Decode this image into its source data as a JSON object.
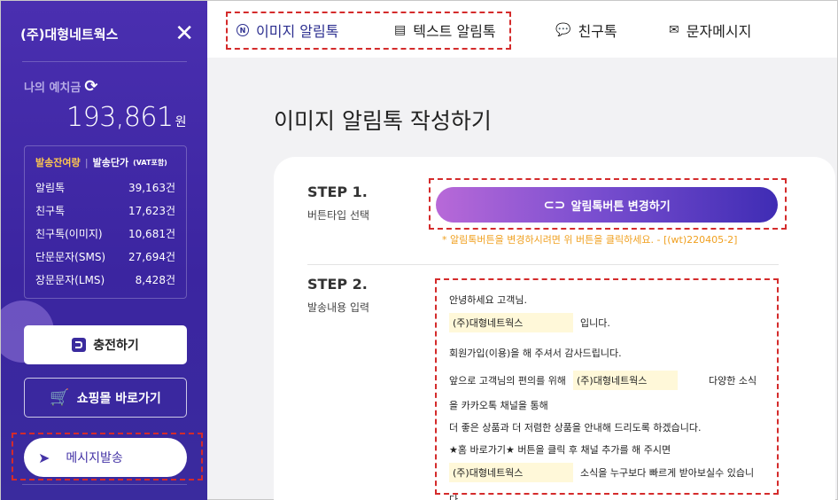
{
  "sidebar": {
    "company": "(주)대형네트웍스",
    "deposit_label": "나의 예치금",
    "deposit_amount": "193,861",
    "deposit_unit": "원",
    "stats_tab_active": "발송잔여량",
    "stats_tab_other": "발송단가",
    "stats_tab_vat": "(VAT포함)",
    "stats": [
      {
        "label": "알림톡",
        "value": "39,163건"
      },
      {
        "label": "친구톡",
        "value": "17,623건"
      },
      {
        "label": "친구톡(이미지)",
        "value": "10,681건"
      },
      {
        "label": "단문문자(SMS)",
        "value": "27,694건"
      },
      {
        "label": "장문문자(LMS)",
        "value": "8,428건"
      }
    ],
    "charge_button": "충전하기",
    "shop_button": "쇼핑몰 바로가기",
    "message_button": "메시지발송"
  },
  "tabs": [
    {
      "label": "이미지 알림톡",
      "icon": "n-circle-icon"
    },
    {
      "label": "텍스트 알림톡",
      "icon": "message-square-icon"
    },
    {
      "label": "친구톡",
      "icon": "chat-bubble-icon"
    },
    {
      "label": "문자메시지",
      "icon": "envelope-icon"
    }
  ],
  "main": {
    "page_title": "이미지 알림톡 작성하기",
    "step1_title": "STEP 1.",
    "step1_sub": "버튼타입 선택",
    "change_button": "알림톡버튼 변경하기",
    "change_note": "* 알림톡버튼을 변경하시려면 위 버튼을 클릭하세요. - [(wt)220405-2]",
    "step2_title": "STEP 2.",
    "step2_sub": "발송내용 입력",
    "message": {
      "line1": "안녕하세요 고객님.",
      "var1": "(주)대형네트웍스",
      "line2_after": "입니다.",
      "line3": "회원가입(이용)을 해 주셔서 감사드립니다.",
      "line4_before": "앞으로 고객님의 편의를 위해",
      "var2": "(주)대형네트웍스",
      "line4_after": "다양한 소식",
      "line5": "을 카카오톡 채널을 통해",
      "line6": "더 좋은 상품과 더 저렴한 상품을 안내해 드리도록 하겠습니다.",
      "line7": "★홈 바로가기★ 버튼을 클릭 후 채널 추가를 해 주시면",
      "var3": "(주)대형네트웍스",
      "line8_after": "소식을 누구보다 빠르게 받아보실수 있습니",
      "line9": "다."
    }
  },
  "colors": {
    "sidebar_bg": "#4a2fb0",
    "accent_yellow": "#ffc74e",
    "highlight_dashed": "#d42b2b",
    "variable_bg": "#fff8d9"
  }
}
